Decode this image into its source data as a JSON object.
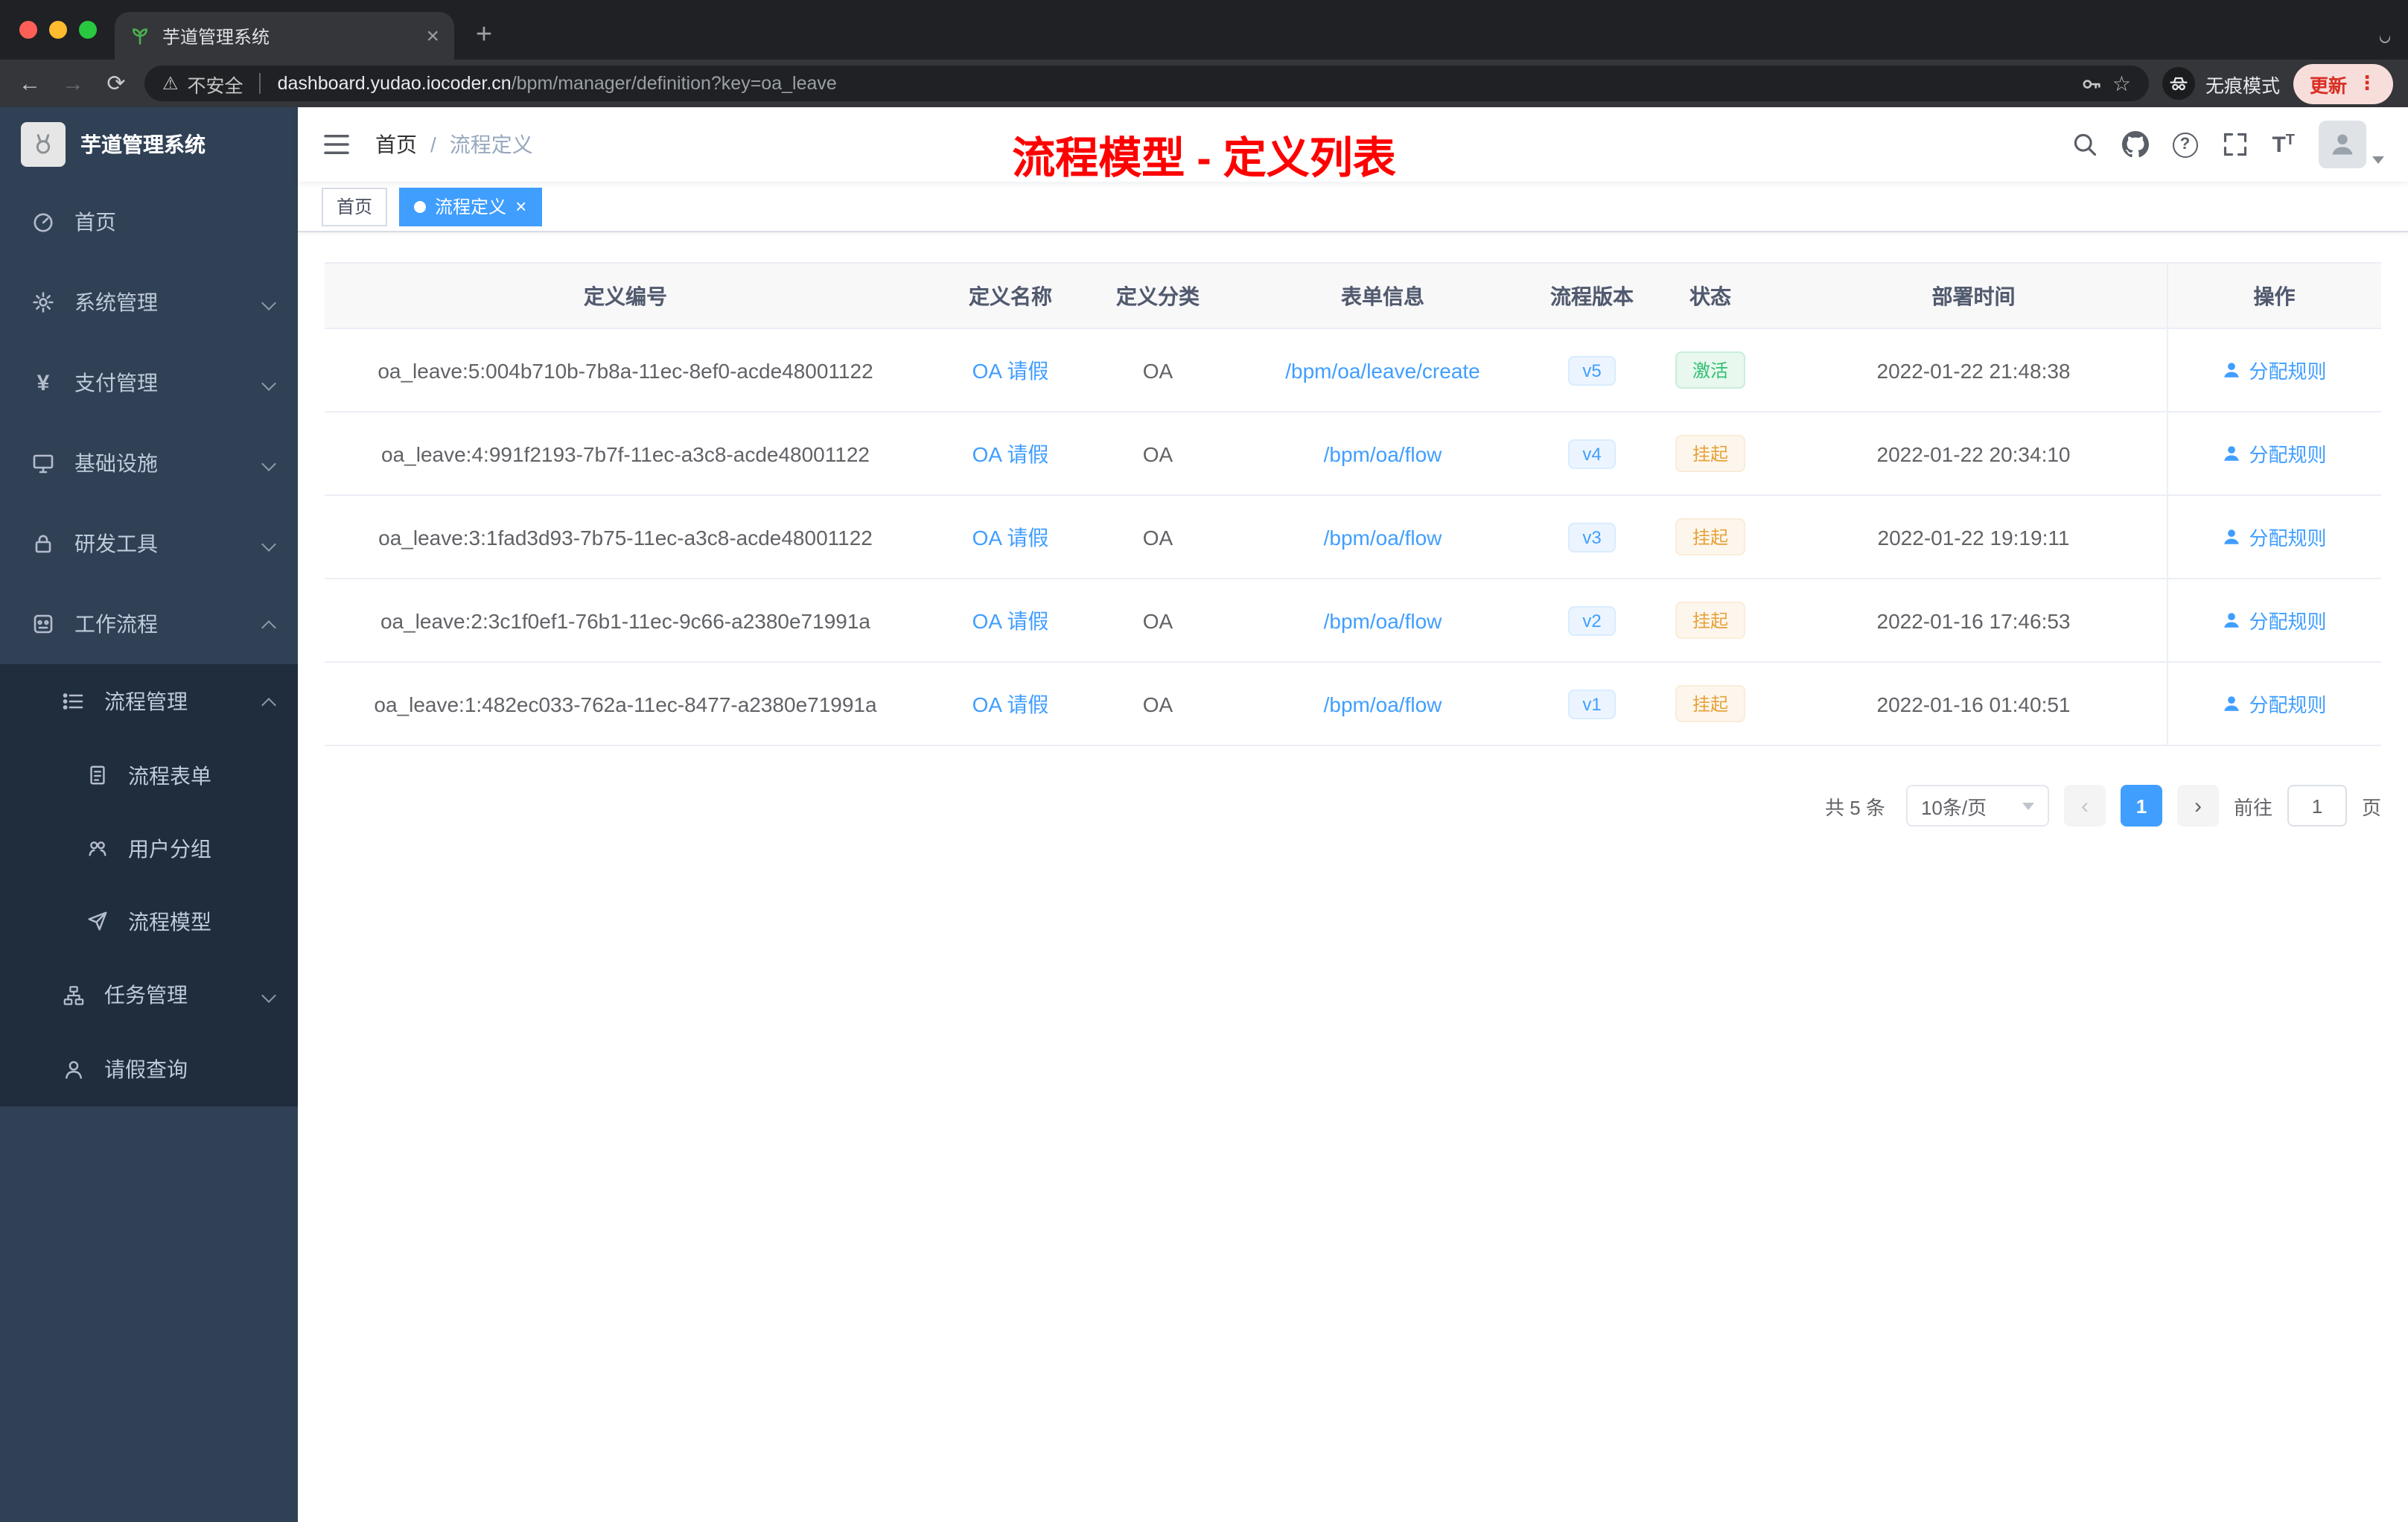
{
  "browser": {
    "tab": {
      "title": "芋道管理系统"
    },
    "nav": {
      "security_label": "不安全",
      "url_domain": "dashboard.yudao.iocoder.cn",
      "url_path": "/bpm/manager/definition?key=oa_leave",
      "incognito_label": "无痕模式",
      "update_label": "更新"
    }
  },
  "sidebar": {
    "app_title": "芋道管理系统",
    "items": [
      {
        "label": "首页"
      },
      {
        "label": "系统管理"
      },
      {
        "label": "支付管理"
      },
      {
        "label": "基础设施"
      },
      {
        "label": "研发工具"
      },
      {
        "label": "工作流程"
      },
      {
        "label": "流程管理"
      },
      {
        "label": "流程表单"
      },
      {
        "label": "用户分组"
      },
      {
        "label": "流程模型"
      },
      {
        "label": "任务管理"
      },
      {
        "label": "请假查询"
      }
    ]
  },
  "navbar": {
    "breadcrumb": {
      "home": "首页",
      "separator": "/",
      "current": "流程定义"
    },
    "annotation": "流程模型 - 定义列表"
  },
  "tags": {
    "home": "首页",
    "current": "流程定义"
  },
  "table": {
    "columns": [
      "定义编号",
      "定义名称",
      "定义分类",
      "表单信息",
      "流程版本",
      "状态",
      "部署时间",
      "操作"
    ],
    "rows": [
      {
        "id": "oa_leave:5:004b710b-7b8a-11ec-8ef0-acde48001122",
        "name": "OA 请假",
        "category": "OA",
        "form": "/bpm/oa/leave/create",
        "version": "v5",
        "status": "激活",
        "time": "2022-01-22 21:48:38",
        "action": "分配规则"
      },
      {
        "id": "oa_leave:4:991f2193-7b7f-11ec-a3c8-acde48001122",
        "name": "OA 请假",
        "category": "OA",
        "form": "/bpm/oa/flow",
        "version": "v4",
        "status": "挂起",
        "time": "2022-01-22 20:34:10",
        "action": "分配规则"
      },
      {
        "id": "oa_leave:3:1fad3d93-7b75-11ec-a3c8-acde48001122",
        "name": "OA 请假",
        "category": "OA",
        "form": "/bpm/oa/flow",
        "version": "v3",
        "status": "挂起",
        "time": "2022-01-22 19:19:11",
        "action": "分配规则"
      },
      {
        "id": "oa_leave:2:3c1f0ef1-76b1-11ec-9c66-a2380e71991a",
        "name": "OA 请假",
        "category": "OA",
        "form": "/bpm/oa/flow",
        "version": "v2",
        "status": "挂起",
        "time": "2022-01-16 17:46:53",
        "action": "分配规则"
      },
      {
        "id": "oa_leave:1:482ec033-762a-11ec-8477-a2380e71991a",
        "name": "OA 请假",
        "category": "OA",
        "form": "/bpm/oa/flow",
        "version": "v1",
        "status": "挂起",
        "time": "2022-01-16 01:40:51",
        "action": "分配规则"
      }
    ]
  },
  "pagination": {
    "total": "共 5 条",
    "page_size": "10条/页",
    "current_page": "1",
    "goto_label": "前往",
    "goto_value": "1",
    "unit": "页"
  },
  "colors": {
    "primary": "#409eff",
    "success": "#2fbf71",
    "warning": "#e6a23c",
    "annotation": "#ff0000",
    "sidebar_bg": "#304156",
    "submenu_bg": "#1f2d3d"
  },
  "icons": {
    "favicon": "sprout-leaf",
    "security": "warning-triangle",
    "passwords": "key",
    "bookmark": "star",
    "incognito": "incognito-face",
    "browser_menu": "kebab-dots",
    "sidebar_toggle": "hamburger-lines",
    "search": "magnifier",
    "github": "github-mark",
    "help": "question-circle",
    "fullscreen": "expand-corners",
    "font_size": "text-T",
    "assign": "person"
  }
}
